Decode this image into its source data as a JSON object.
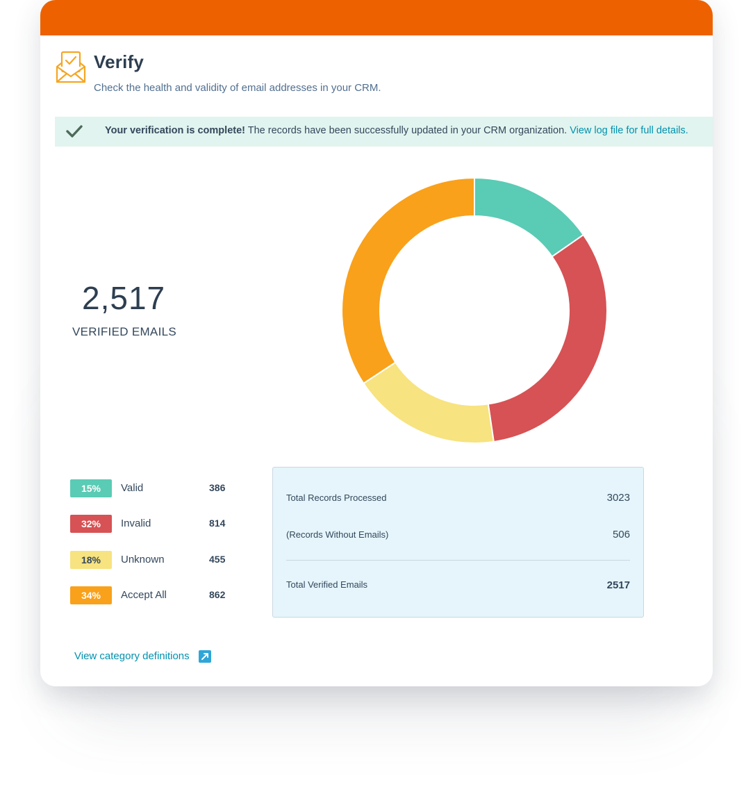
{
  "header": {
    "title": "Verify",
    "subtitle": "Check the health and validity of email addresses in your CRM.",
    "icon": "envelope-check-icon"
  },
  "alert": {
    "icon": "check-icon",
    "strong_text": "Your verification is complete!",
    "text": " The records have been successfully updated in your CRM organization. ",
    "link_text": "View log file for full details."
  },
  "summary_stat": {
    "value": "2,517",
    "label": "VERIFIED EMAILS"
  },
  "chart_data": {
    "type": "pie",
    "donut": true,
    "categories": [
      "Valid",
      "Invalid",
      "Unknown",
      "Accept All"
    ],
    "values": [
      386,
      814,
      455,
      862
    ],
    "percent_labels": [
      "15%",
      "32%",
      "18%",
      "34%"
    ],
    "colors": [
      "#5acbb4",
      "#d65254",
      "#f7e37f",
      "#f9a11b"
    ]
  },
  "legend": [
    {
      "percent": "15%",
      "label": "Valid",
      "count": "386",
      "color": "#5acbb4",
      "text_color": "#ffffff"
    },
    {
      "percent": "32%",
      "label": "Invalid",
      "count": "814",
      "color": "#d65254",
      "text_color": "#ffffff"
    },
    {
      "percent": "18%",
      "label": "Unknown",
      "count": "455",
      "color": "#f7e37f",
      "text_color": "#33475b"
    },
    {
      "percent": "34%",
      "label": "Accept All",
      "count": "862",
      "color": "#f9a11b",
      "text_color": "#ffffff"
    }
  ],
  "summary_table": {
    "rows": [
      {
        "label": "Total Records Processed",
        "value": "3023"
      },
      {
        "label": "(Records Without Emails)",
        "value": "506"
      },
      {
        "label": "Total Verified Emails",
        "value": "2517"
      }
    ]
  },
  "footer": {
    "link_text": "View category definitions",
    "link_icon": "external-link-icon"
  },
  "colors": {
    "brand_orange": "#ee6100",
    "link": "#0091ae",
    "alert_bg": "#e1f4ef",
    "summary_bg": "#e5f5fb"
  }
}
